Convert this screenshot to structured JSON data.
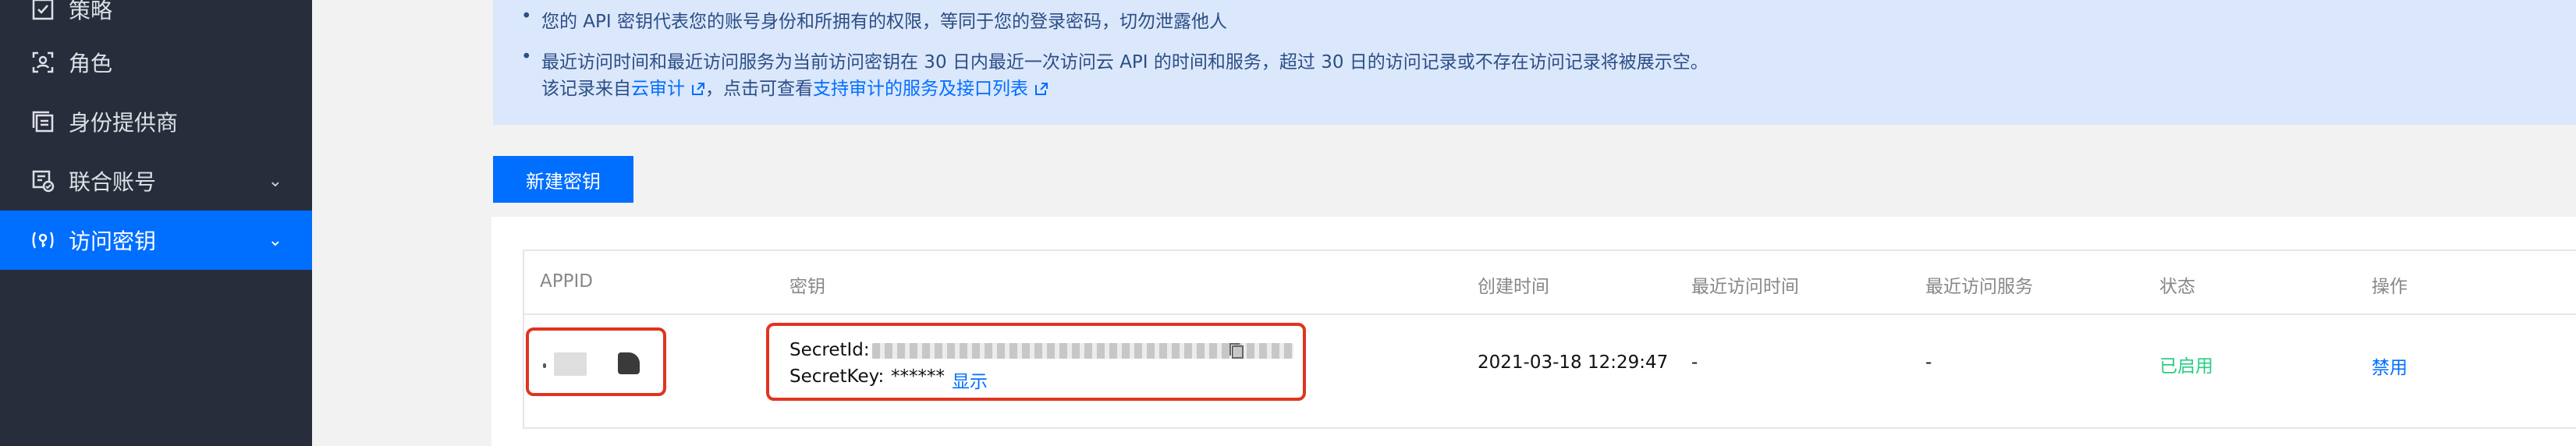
{
  "sidebar": {
    "items": [
      {
        "label": "策略",
        "icon": "policy-icon"
      },
      {
        "label": "角色",
        "icon": "role-icon"
      },
      {
        "label": "身份提供商",
        "icon": "identity-provider-icon"
      },
      {
        "label": "联合账号",
        "icon": "federated-account-icon",
        "chevron": "⌄"
      },
      {
        "label": "访问密钥",
        "icon": "access-key-icon",
        "chevron": "⌄",
        "active": true
      }
    ]
  },
  "notice": {
    "line1": "您的 API 密钥代表您的账号身份和所拥有的权限，等同于您的登录密码，切勿泄露他人",
    "line2": "最近访问时间和最近访问服务为当前访问密钥在 30 日内最近一次访问云 API 的时间和服务，超过 30 日的访问记录或不存在访问记录将被展示空。",
    "line3_prefix": "该记录来自",
    "line3_link1": "云审计",
    "line3_middle": "，点击可查看",
    "line3_link2": "支持审计的服务及接口列表",
    "bullet": "•"
  },
  "actions": {
    "new_key": "新建密钥"
  },
  "table": {
    "headers": [
      "APPID",
      "密钥",
      "创建时间",
      "最近访问时间",
      "最近访问服务",
      "状态",
      "操作"
    ],
    "rows": [
      {
        "secret_id_label": "SecretId:",
        "secret_key_label": "SecretKey:",
        "secret_key_value": "******",
        "show_link": "显示",
        "created": "2021-03-18 12:29:47",
        "last_access_time": "-",
        "last_access_service": "-",
        "status": "已启用",
        "action": "禁用"
      }
    ]
  },
  "colors": {
    "sidebar_bg": "#282d3c",
    "accent": "#006eff",
    "notice_bg": "#dbe7fb",
    "status_enabled": "#29cc85",
    "highlight_red": "#e0341f"
  }
}
